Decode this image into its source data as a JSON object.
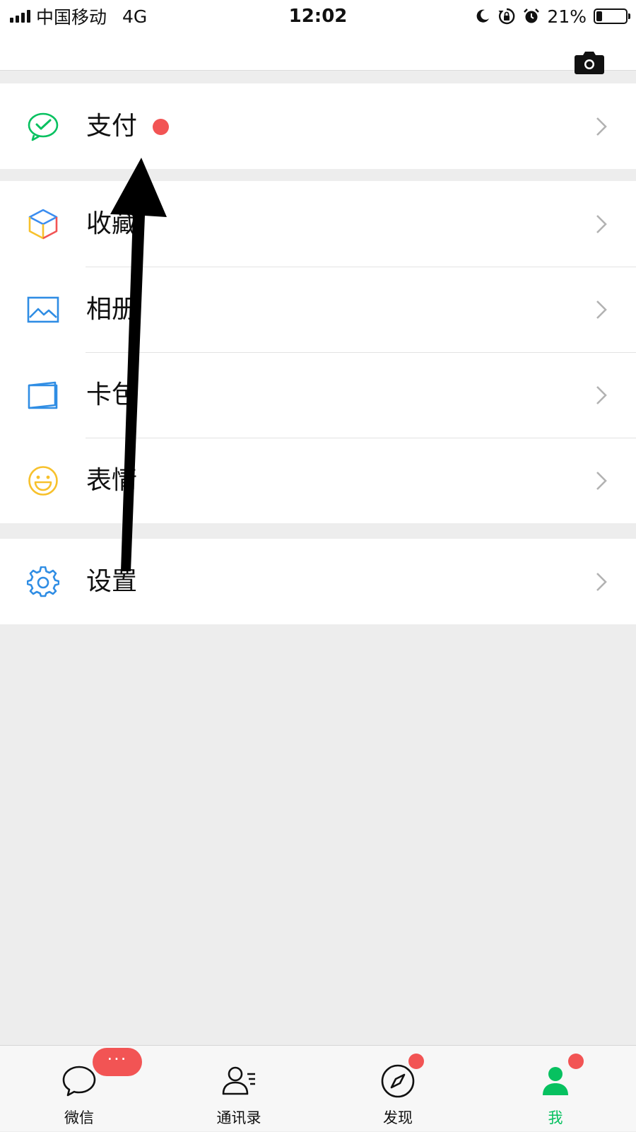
{
  "status_bar": {
    "carrier": "中国移动",
    "network": "4G",
    "time": "12:02",
    "battery": "21%",
    "battery_level": 0.21
  },
  "header": {
    "camera_icon": "camera-icon"
  },
  "menu": [
    {
      "label": "支付",
      "icon": "pay-icon",
      "color": "#07c160",
      "has_badge": true
    },
    {
      "label": "收藏",
      "icon": "favorites-cube-icon",
      "color": "#3b8df0"
    },
    {
      "label": "相册",
      "icon": "album-icon",
      "color": "#2f8de4"
    },
    {
      "label": "卡包",
      "icon": "card-wallet-icon",
      "color": "#2f8de4"
    },
    {
      "label": "表情",
      "icon": "emoji-smile-icon",
      "color": "#f7c12c"
    },
    {
      "label": "设置",
      "icon": "settings-gear-icon",
      "color": "#2f8de4"
    }
  ],
  "annotation": {
    "type": "arrow",
    "color": "#000000",
    "points_to": "支付"
  },
  "tabbar": {
    "tabs": [
      {
        "label": "微信",
        "icon": "chat-bubble-icon"
      },
      {
        "label": "通讯录",
        "icon": "contacts-icon"
      },
      {
        "label": "发现",
        "icon": "compass-icon"
      },
      {
        "label": "我",
        "icon": "me-person-icon",
        "active": true
      }
    ],
    "unread_badge": "···"
  },
  "colors": {
    "accent_green": "#07c160",
    "badge_red": "#f25454",
    "background": "#ededed"
  }
}
